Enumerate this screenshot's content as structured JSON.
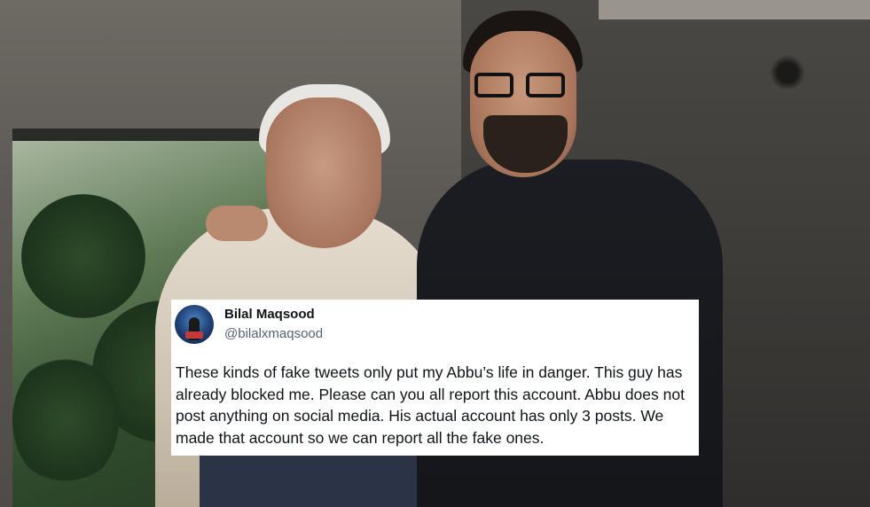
{
  "tweet": {
    "display_name": "Bilal Maqsood",
    "handle": "@bilalxmaqsood",
    "text": "These kinds of fake tweets only put my Abbu’s life in danger. This guy has already blocked me. Please can you all report this account. Abbu does not post anything on social media. His actual account has only 3 posts. We made that account so we can report all the fake ones."
  },
  "photo": {
    "subject": "two-men-portrait"
  },
  "colors": {
    "card_bg": "#ffffff",
    "name": "#0f1419",
    "handle": "#536471"
  }
}
